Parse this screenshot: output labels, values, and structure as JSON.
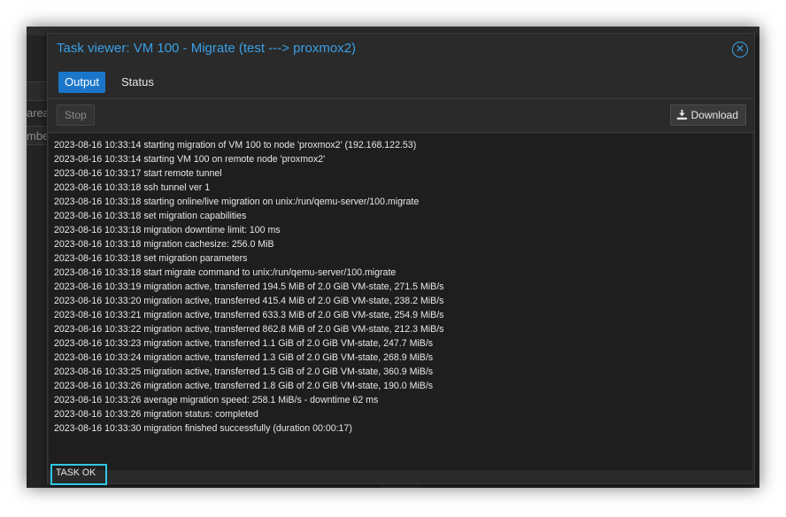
{
  "dialog": {
    "title": "Task viewer: VM 100 - Migrate (test ---> proxmox2)",
    "close_icon": "close-circle-icon"
  },
  "background": {
    "partial_text_1": "area",
    "partial_text_2": "mbe"
  },
  "tabs": [
    {
      "label": "Output",
      "active": true
    },
    {
      "label": "Status",
      "active": false
    }
  ],
  "toolbar": {
    "stop_label": "Stop",
    "download_label": "Download",
    "download_icon": "download-icon"
  },
  "log": [
    "2023-08-16 10:33:14 starting migration of VM 100 to node 'proxmox2' (192.168.122.53)",
    "2023-08-16 10:33:14 starting VM 100 on remote node 'proxmox2'",
    "2023-08-16 10:33:17 start remote tunnel",
    "2023-08-16 10:33:18 ssh tunnel ver 1",
    "2023-08-16 10:33:18 starting online/live migration on unix:/run/qemu-server/100.migrate",
    "2023-08-16 10:33:18 set migration capabilities",
    "2023-08-16 10:33:18 migration downtime limit: 100 ms",
    "2023-08-16 10:33:18 migration cachesize: 256.0 MiB",
    "2023-08-16 10:33:18 set migration parameters",
    "2023-08-16 10:33:18 start migrate command to unix:/run/qemu-server/100.migrate",
    "2023-08-16 10:33:19 migration active, transferred 194.5 MiB of 2.0 GiB VM-state, 271.5 MiB/s",
    "2023-08-16 10:33:20 migration active, transferred 415.4 MiB of 2.0 GiB VM-state, 238.2 MiB/s",
    "2023-08-16 10:33:21 migration active, transferred 633.3 MiB of 2.0 GiB VM-state, 254.9 MiB/s",
    "2023-08-16 10:33:22 migration active, transferred 862.8 MiB of 2.0 GiB VM-state, 212.3 MiB/s",
    "2023-08-16 10:33:23 migration active, transferred 1.1 GiB of 2.0 GiB VM-state, 247.7 MiB/s",
    "2023-08-16 10:33:24 migration active, transferred 1.3 GiB of 2.0 GiB VM-state, 268.9 MiB/s",
    "2023-08-16 10:33:25 migration active, transferred 1.5 GiB of 2.0 GiB VM-state, 360.9 MiB/s",
    "2023-08-16 10:33:26 migration active, transferred 1.8 GiB of 2.0 GiB VM-state, 190.0 MiB/s",
    "2023-08-16 10:33:26 average migration speed: 258.1 MiB/s - downtime 62 ms",
    "2023-08-16 10:33:26 migration status: completed",
    "2023-08-16 10:33:30 migration finished successfully (duration 00:00:17)"
  ],
  "final_status": "TASK OK",
  "colors": {
    "accent": "#1a76c9",
    "title": "#39a0e6",
    "highlight": "#2ec8e6"
  }
}
